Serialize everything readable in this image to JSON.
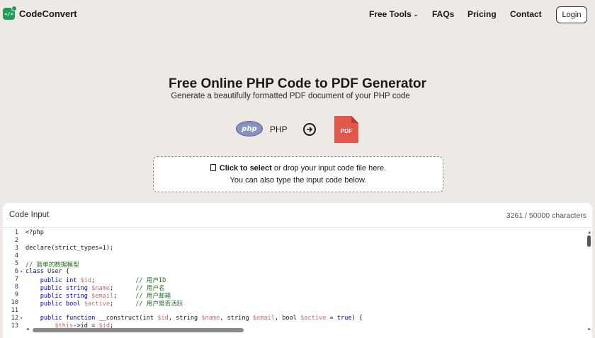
{
  "brand": {
    "name": "CodeConvert",
    "logo_icon": "code-bracket-sparkle-icon",
    "logo_glyph": "</>"
  },
  "nav": {
    "free_tools": "Free Tools",
    "faqs": "FAQs",
    "pricing": "Pricing",
    "contact": "Contact",
    "login": "Login"
  },
  "hero": {
    "title": "Free Online PHP Code to PDF Generator",
    "subtitle": "Generate a beautifully formatted PDF document of your PHP code",
    "source_logo": "php",
    "source_label": "PHP",
    "target_label": "PDF"
  },
  "dropzone": {
    "click_text": "Click to select",
    "rest_text": " or drop your input code file here.",
    "line2": "You can also type the input code below."
  },
  "editor": {
    "title": "Code Input",
    "char_count": "3261 / 50000 characters",
    "lines": [
      {
        "n": "1",
        "fold": false
      },
      {
        "n": "2",
        "fold": false
      },
      {
        "n": "3",
        "fold": false
      },
      {
        "n": "4",
        "fold": false
      },
      {
        "n": "5",
        "fold": false
      },
      {
        "n": "6",
        "fold": true
      },
      {
        "n": "7",
        "fold": false
      },
      {
        "n": "8",
        "fold": false
      },
      {
        "n": "9",
        "fold": false
      },
      {
        "n": "10",
        "fold": false
      },
      {
        "n": "11",
        "fold": false
      },
      {
        "n": "12",
        "fold": true
      },
      {
        "n": "13",
        "fold": false
      }
    ],
    "code": {
      "l1": "<?php",
      "l3": "declare(strict_types=1);",
      "l5": "// 简单的数据模型",
      "l6a": "class",
      "l6b": " User {",
      "l7a": "    public int ",
      "l7b": "$id",
      "l7c": ";           ",
      "l7d": "// 用户ID",
      "l8a": "    public string ",
      "l8b": "$name",
      "l8c": ";      ",
      "l8d": "// 用户名",
      "l9a": "    public string ",
      "l9b": "$email",
      "l9c": ";     ",
      "l9d": "// 用户邮箱",
      "l10a": "    public bool ",
      "l10b": "$active",
      "l10c": ";      ",
      "l10d": "// 用户是否活跃",
      "l12a": "    public ",
      "l12b": "function",
      "l12c": " __construct(int ",
      "l12d": "$id",
      "l12e": ", string ",
      "l12f": "$name",
      "l12g": ", string ",
      "l12h": "$email",
      "l12i": ", bool ",
      "l12j": "$active",
      "l12k": " = ",
      "l12l": "true",
      "l12m": ") {",
      "l13a": "        ",
      "l13b": "$this",
      "l13c": "->id = ",
      "l13d": "$id",
      "l13e": ";"
    }
  },
  "colors": {
    "page_bg": "#eee9e4",
    "brand_green": "#1f9d55",
    "pdf_red": "#e2574c",
    "php_purple": "#8892bf"
  }
}
